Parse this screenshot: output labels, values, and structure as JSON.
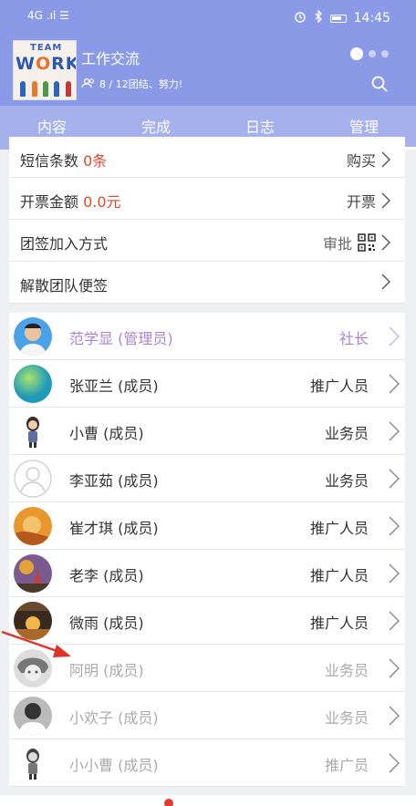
{
  "status_bar": {
    "signal": "4G .ıl ☰",
    "time": "14:45"
  },
  "header": {
    "logo_team": "TEAM",
    "logo_work_1": "W",
    "logo_work_o": "O",
    "logo_work_2": "RK",
    "team_name": "工作交流",
    "team_meta": "8 / 12团结、努力!"
  },
  "tabs": [
    "内容",
    "完成",
    "日志",
    "管理"
  ],
  "settings": {
    "sms_label": "短信条数",
    "sms_value": "0条",
    "sms_action": "购买",
    "invoice_label": "开票金额",
    "invoice_value": "0.0元",
    "invoice_action": "开票",
    "join_label": "团签加入方式",
    "join_action": "审批",
    "dissolve_label": "解散团队便签"
  },
  "members": [
    {
      "name": "范学显 (管理员)",
      "role": "社长"
    },
    {
      "name": "张亚兰 (成员)",
      "role": "推广人员"
    },
    {
      "name": "小曹 (成员)",
      "role": "业务员"
    },
    {
      "name": "李亚茹 (成员)",
      "role": "业务员"
    },
    {
      "name": "崔才琪 (成员)",
      "role": "推广人员"
    },
    {
      "name": "老李 (成员)",
      "role": "推广人员"
    },
    {
      "name": "微雨 (成员)",
      "role": "推广人员"
    },
    {
      "name": "阿明 (成员)",
      "role": "业务员"
    },
    {
      "name": "小欢子 (成员)",
      "role": "业务员"
    },
    {
      "name": "小小曹 (成员)",
      "role": "推广员"
    }
  ],
  "colors": {
    "header": "#8b9ae6",
    "tabs": "#a5b0ec",
    "admin": "#a983d6",
    "accent_red": "#e1472b"
  }
}
